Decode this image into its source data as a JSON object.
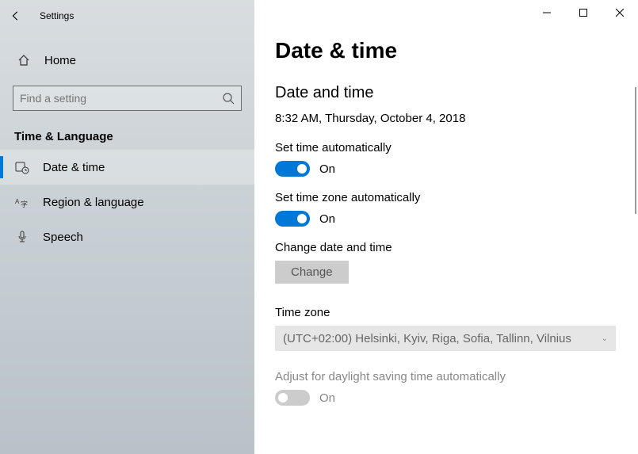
{
  "window": {
    "app_title": "Settings"
  },
  "sidebar": {
    "home_label": "Home",
    "search_placeholder": "Find a setting",
    "category_title": "Time & Language",
    "items": [
      {
        "label": "Date & time"
      },
      {
        "label": "Region & language"
      },
      {
        "label": "Speech"
      }
    ]
  },
  "main": {
    "heading": "Date & time",
    "section_title": "Date and time",
    "current_datetime": "8:32 AM, Thursday, October 4, 2018",
    "set_time_auto": {
      "label": "Set time automatically",
      "state_text": "On"
    },
    "set_tz_auto": {
      "label": "Set time zone automatically",
      "state_text": "On"
    },
    "change_dt": {
      "label": "Change date and time",
      "button": "Change"
    },
    "timezone": {
      "label": "Time zone",
      "value": "(UTC+02:00) Helsinki, Kyiv, Riga, Sofia, Tallinn, Vilnius"
    },
    "dst": {
      "label": "Adjust for daylight saving time automatically",
      "state_text": "On"
    }
  }
}
